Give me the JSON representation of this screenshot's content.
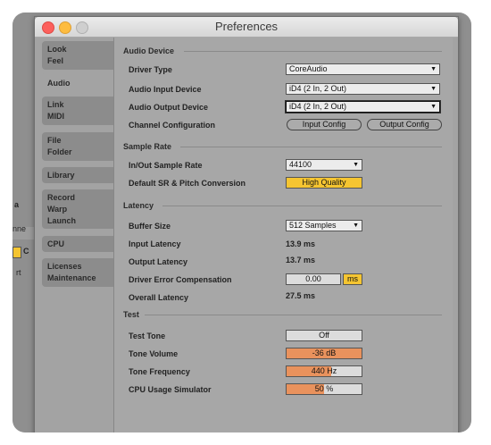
{
  "window": {
    "title": "Preferences"
  },
  "sidebar": {
    "tabs": [
      {
        "lines": [
          "Look",
          "Feel"
        ]
      },
      {
        "lines": [
          "Audio"
        ]
      },
      {
        "lines": [
          "Link",
          "MIDI"
        ]
      },
      {
        "lines": [
          "File",
          "Folder"
        ]
      },
      {
        "lines": [
          "Library"
        ]
      },
      {
        "lines": [
          "Record",
          "Warp",
          "Launch"
        ]
      },
      {
        "lines": [
          "CPU"
        ]
      },
      {
        "lines": [
          "Licenses",
          "Maintenance"
        ]
      }
    ],
    "active": "Audio"
  },
  "background_snippets": [
    "a",
    "nne",
    "C",
    "rt"
  ],
  "audio_device": {
    "section": "Audio Device",
    "driver_type_label": "Driver Type",
    "driver_type_value": "CoreAudio",
    "input_device_label": "Audio Input Device",
    "input_device_value": "iD4 (2 In, 2 Out)",
    "output_device_label": "Audio Output Device",
    "output_device_value": "iD4 (2 In, 2 Out)",
    "channel_config_label": "Channel Configuration",
    "input_config_button": "Input Config",
    "output_config_button": "Output Config"
  },
  "sample_rate": {
    "section": "Sample Rate",
    "rate_label": "In/Out Sample Rate",
    "rate_value": "44100",
    "conversion_label": "Default SR & Pitch Conversion",
    "conversion_value": "High Quality"
  },
  "latency": {
    "section": "Latency",
    "buffer_label": "Buffer Size",
    "buffer_value": "512 Samples",
    "input_latency_label": "Input Latency",
    "input_latency_value": "13.9 ms",
    "output_latency_label": "Output Latency",
    "output_latency_value": "13.7 ms",
    "error_comp_label": "Driver Error Compensation",
    "error_comp_value": "0.00",
    "error_comp_unit": "ms",
    "overall_label": "Overall Latency",
    "overall_value": "27.5 ms"
  },
  "test": {
    "section": "Test",
    "tone_label": "Test Tone",
    "tone_value": "Off",
    "volume_label": "Tone Volume",
    "volume_value": "-36 dB",
    "frequency_label": "Tone Frequency",
    "frequency_value": "440 Hz",
    "cpu_label": "CPU Usage Simulator",
    "cpu_value": "50 %",
    "frequency_fill_fraction": 0.6,
    "cpu_fill_fraction": 0.5
  },
  "colors": {
    "active_orange": "#e9925d",
    "highlight_yellow": "#f5c531"
  }
}
